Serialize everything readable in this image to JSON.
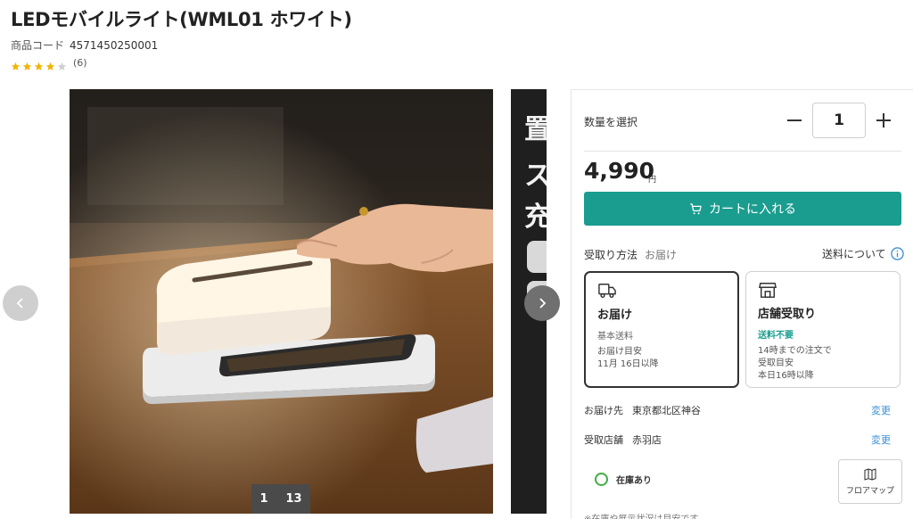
{
  "product": {
    "title": "LEDモバイルライト(WML01 ホワイト)",
    "code_label": "商品コード",
    "code_value": "4571450250001",
    "rating_stars": 4,
    "rating_max": 5,
    "review_count": "(6)"
  },
  "gallery": {
    "current_index": "1",
    "total": "13",
    "peek_chars": [
      "置",
      "ス",
      "充"
    ]
  },
  "purchase": {
    "qty_label": "数量を選択",
    "qty_value": "1",
    "price": "4,990",
    "currency": "円",
    "cart_button": "カートに入れる",
    "receive_label": "受取り方法",
    "receive_selected": "お届け",
    "shipping_info_link": "送料について",
    "options": [
      {
        "title": "お届け",
        "sub": "基本送料",
        "note_line1": "お届け目安",
        "note_line2": "11月 16日以降",
        "selected": true
      },
      {
        "title": "店舗受取り",
        "sub": "送料不要",
        "note_line1": "14時までの注文で",
        "note_line2": "受取目安",
        "note_line3": "本日16時以降",
        "selected": false
      }
    ],
    "destination_label": "お届け先",
    "destination_value": "東京都北区神谷",
    "change_label": "変更",
    "store_label": "受取店舗",
    "store_value": "赤羽店",
    "stock_label": "在庫あり",
    "floor_map_label": "フロアマップ",
    "footnote": "※在庫や展示状況は目安です"
  },
  "colors": {
    "accent": "#1a9d8f",
    "link": "#3b8fd4",
    "stock_green": "#3fae3f",
    "star": "#f0b400"
  }
}
